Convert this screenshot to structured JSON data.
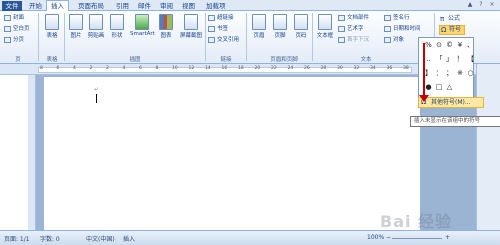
{
  "tabs": [
    "文件",
    "开始",
    "插入",
    "页面布局",
    "引用",
    "邮件",
    "审阅",
    "视图",
    "加载项"
  ],
  "window_controls": [
    "▲",
    "?",
    "×"
  ],
  "ribbon": {
    "page_group": {
      "items": [
        "封面",
        "空白页",
        "分页"
      ],
      "label": "页"
    },
    "table": {
      "label": "表格",
      "group": "表格"
    },
    "illustrations": {
      "buttons": [
        "图片",
        "剪贴画",
        "形状",
        "SmartArt",
        "图表",
        "屏幕截图"
      ],
      "label": "插图"
    },
    "links": {
      "items": [
        "超链接",
        "书签",
        "交叉引用"
      ],
      "label": "链接"
    },
    "header_footer": {
      "buttons": [
        "页眉",
        "页脚",
        "页码"
      ],
      "label": "页眉和页脚"
    },
    "text": {
      "textbox": "文本框",
      "items": [
        "文档部件",
        "艺术字",
        "首字下沉"
      ],
      "items2": [
        "签名行",
        "日期和时间",
        "对象"
      ],
      "label": "文本"
    },
    "symbols": {
      "formula": "公式",
      "symbol": "符号"
    }
  },
  "ruler_numbers": [
    "8",
    "6",
    "4",
    "2",
    "2",
    "4",
    "6",
    "8",
    "10",
    "12",
    "14",
    "16",
    "18",
    "20",
    "22",
    "24",
    "26",
    "28",
    "30",
    "32",
    "34",
    "36",
    "38"
  ],
  "document": {
    "paragraph_mark": "↵"
  },
  "symbol_panel": {
    "symbols": [
      "%",
      "⊙",
      "©",
      "¥",
      "、",
      "‥",
      "「",
      "」",
      "！",
      "【",
      "】",
      "：",
      "；",
      "※",
      "○",
      "●",
      "□",
      "△"
    ],
    "more_symbols": "其他符号(M)...",
    "tooltip": "插入未显示在该组中的符号"
  },
  "statusbar": {
    "page": "页面: 1/1",
    "words": "字数: 0",
    "language": "中文(中国)",
    "mode": "插入",
    "zoom": "100%",
    "zoom_minus": "−",
    "zoom_plus": "+"
  },
  "watermark": "Bai 经验"
}
